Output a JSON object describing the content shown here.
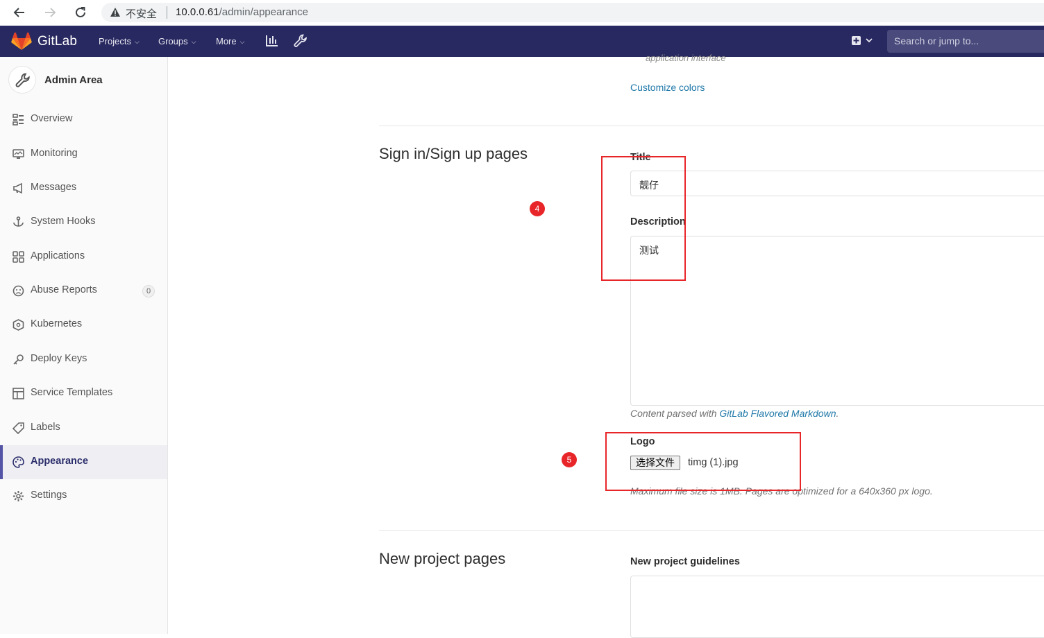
{
  "browser": {
    "security_label": "不安全",
    "url_host": "10.0.0.61",
    "url_path": "/admin/appearance"
  },
  "navbar": {
    "brand": "GitLab",
    "items": [
      {
        "label": "Projects"
      },
      {
        "label": "Groups"
      },
      {
        "label": "More"
      }
    ],
    "search_placeholder": "Search or jump to..."
  },
  "sidebar": {
    "title": "Admin Area",
    "items": [
      {
        "label": "Overview",
        "icon": "overview-icon"
      },
      {
        "label": "Monitoring",
        "icon": "monitor-icon"
      },
      {
        "label": "Messages",
        "icon": "megaphone-icon"
      },
      {
        "label": "System Hooks",
        "icon": "hook-icon"
      },
      {
        "label": "Applications",
        "icon": "applications-icon"
      },
      {
        "label": "Abuse Reports",
        "icon": "abuse-icon",
        "badge": "0"
      },
      {
        "label": "Kubernetes",
        "icon": "kubernetes-icon"
      },
      {
        "label": "Deploy Keys",
        "icon": "key-icon"
      },
      {
        "label": "Service Templates",
        "icon": "template-icon"
      },
      {
        "label": "Labels",
        "icon": "label-icon"
      },
      {
        "label": "Appearance",
        "icon": "palette-icon",
        "active": true
      },
      {
        "label": "Settings",
        "icon": "gear-icon"
      }
    ]
  },
  "content": {
    "faint_text": "application interface",
    "customize_link": "Customize colors",
    "signin": {
      "section_title": "Sign in/Sign up pages",
      "title_label": "Title",
      "title_value": "靓仔",
      "description_label": "Description",
      "description_value": "测试",
      "markdown_help_prefix": "Content parsed with ",
      "markdown_help_link": "GitLab Flavored Markdown",
      "markdown_help_suffix": ".",
      "logo_label": "Logo",
      "file_button": "选择文件",
      "file_name": "timg (1).jpg",
      "logo_help": "Maximum file size is 1MB. Pages are optimized for a 640x360 px logo."
    },
    "new_project": {
      "section_title": "New project pages",
      "guidelines_label": "New project guidelines"
    }
  },
  "annotations": {
    "badge_4": "4",
    "badge_5": "5",
    "color": "#e8262a"
  }
}
